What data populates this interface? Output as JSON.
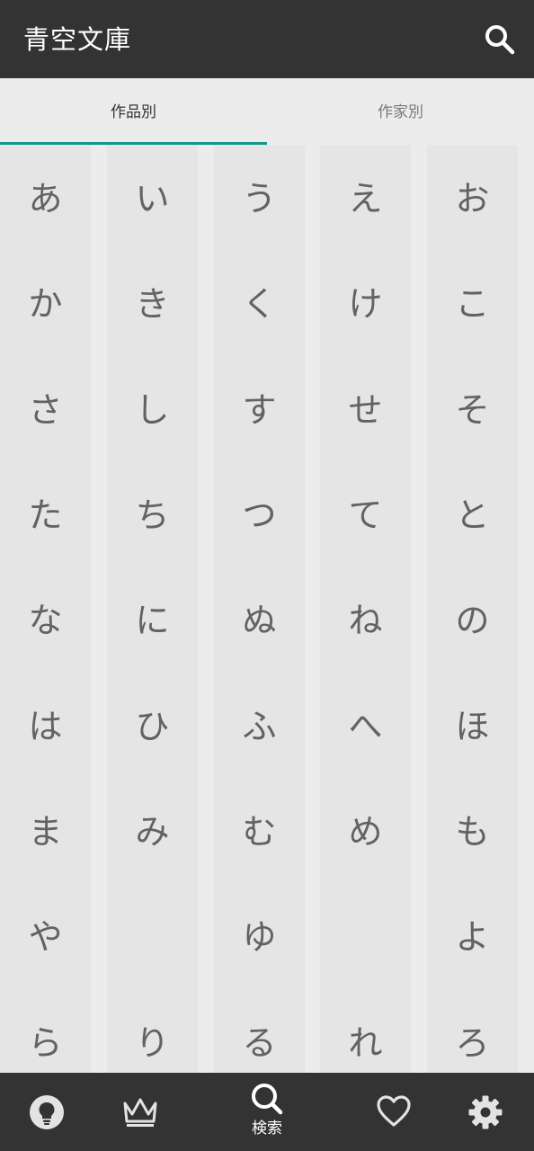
{
  "app": {
    "title": "青空文庫"
  },
  "topbar": {
    "search_icon": "search-icon"
  },
  "tabs": [
    {
      "label": "作品別",
      "selected": true
    },
    {
      "label": "作家別",
      "selected": false
    }
  ],
  "colors": {
    "bar": "#333333",
    "accent": "#12968f",
    "column": "#e5e5e5",
    "background": "#ececec",
    "kana_text": "#626262"
  },
  "kana_columns": [
    [
      "あ",
      "か",
      "さ",
      "た",
      "な",
      "は",
      "ま",
      "や",
      "ら"
    ],
    [
      "い",
      "き",
      "し",
      "ち",
      "に",
      "ひ",
      "み",
      "",
      "り"
    ],
    [
      "う",
      "く",
      "す",
      "つ",
      "ぬ",
      "ふ",
      "む",
      "ゆ",
      "る"
    ],
    [
      "え",
      "け",
      "せ",
      "て",
      "ね",
      "へ",
      "め",
      "",
      "れ"
    ],
    [
      "お",
      "こ",
      "そ",
      "と",
      "の",
      "ほ",
      "も",
      "よ",
      "ろ"
    ]
  ],
  "bottom_nav": [
    {
      "icon": "lightbulb-icon",
      "label": ""
    },
    {
      "icon": "crown-icon",
      "label": ""
    },
    {
      "icon": "search-icon",
      "label": "検索",
      "selected": true
    },
    {
      "icon": "heart-icon",
      "label": ""
    },
    {
      "icon": "gear-icon",
      "label": ""
    }
  ]
}
